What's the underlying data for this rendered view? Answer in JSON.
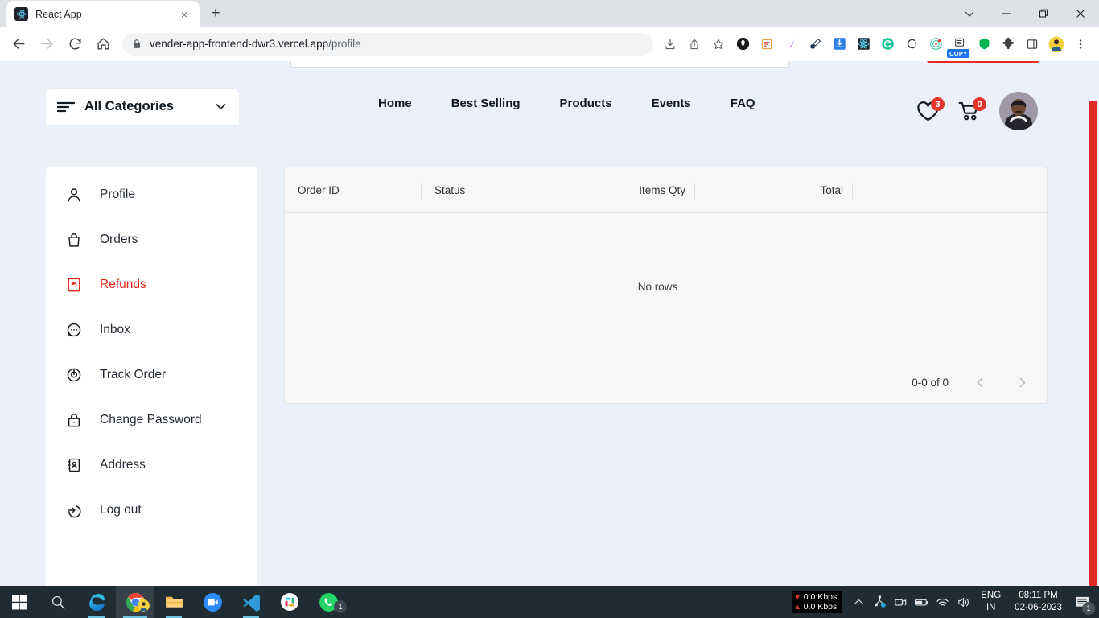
{
  "browser": {
    "tab": {
      "title": "React App",
      "favicon": "react-icon",
      "close": "×"
    },
    "new_tab": "+",
    "window_controls": {
      "minimize": "—",
      "maximize": "❐",
      "close": "✕",
      "tab_search": "⌄"
    },
    "nav": {
      "back": "←",
      "forward": "→",
      "reload": "↻",
      "home": "⌂"
    },
    "omnibox": {
      "lock": "lock-icon",
      "url_host": "vender-app-frontend-dwr3.vercel.app",
      "url_path": "/profile"
    },
    "toolbar_icons": [
      "install-icon",
      "share-icon",
      "bookmark-star-icon",
      "brave-icon",
      "notes-extension-icon",
      "gradient-extension-icon",
      "eyedropper-icon",
      "download-manager-icon",
      "react-devtools-icon",
      "grammarly-icon",
      "c-extension-icon",
      "target-extension-icon",
      "copy-extension-icon",
      "shield-extension-icon",
      "puzzle-extensions-icon",
      "sidepanel-icon",
      "profile-avatar-icon",
      "kebab-menu-icon"
    ],
    "copy_badge_label": "COPY"
  },
  "site": {
    "categories": {
      "label": "All Categories",
      "icon": "menu-lines-icon",
      "chevron": "chevron-down-icon"
    },
    "nav_links": [
      {
        "label": "Home"
      },
      {
        "label": "Best Selling"
      },
      {
        "label": "Products"
      },
      {
        "label": "Events"
      },
      {
        "label": "FAQ"
      }
    ],
    "wishlist": {
      "icon": "heart-icon",
      "count": "3"
    },
    "cart": {
      "icon": "cart-icon",
      "count": "0"
    },
    "avatar": {
      "icon": "user-avatar"
    }
  },
  "sidebar": {
    "items": [
      {
        "label": "Profile",
        "icon": "user-icon",
        "active": false
      },
      {
        "label": "Orders",
        "icon": "bag-icon",
        "active": false
      },
      {
        "label": "Refunds",
        "icon": "refund-icon",
        "active": true
      },
      {
        "label": "Inbox",
        "icon": "chat-bubble-icon",
        "active": false
      },
      {
        "label": "Track Order",
        "icon": "track-target-icon",
        "active": false
      },
      {
        "label": "Change Password",
        "icon": "lock-icon",
        "active": false
      },
      {
        "label": "Address",
        "icon": "address-book-icon",
        "active": false
      },
      {
        "label": "Log out",
        "icon": "logout-icon",
        "active": false
      }
    ],
    "active_color": "#e2231a"
  },
  "table": {
    "columns": [
      {
        "label": "Order ID"
      },
      {
        "label": "Status"
      },
      {
        "label": "Items Qty"
      },
      {
        "label": "Total"
      }
    ],
    "empty_message": "No rows",
    "pagination": {
      "range_label": "0-0 of 0",
      "prev_icon": "chevron-left-icon",
      "next_icon": "chevron-right-icon"
    }
  },
  "taskbar": {
    "apps": [
      {
        "name": "start-button",
        "icon": "windows-logo-icon"
      },
      {
        "name": "search-button",
        "icon": "search-icon"
      },
      {
        "name": "edge",
        "icon": "edge-icon"
      },
      {
        "name": "chrome",
        "icon": "chrome-icon"
      },
      {
        "name": "file-explorer",
        "icon": "folder-icon"
      },
      {
        "name": "zoom",
        "icon": "zoom-icon"
      },
      {
        "name": "vscode",
        "icon": "vscode-icon"
      },
      {
        "name": "slack",
        "icon": "slack-icon"
      },
      {
        "name": "whatsapp",
        "icon": "whatsapp-icon",
        "badge": "1"
      }
    ],
    "network_meter": {
      "down": "0.0 Kbps",
      "up": "0.0 Kbps"
    },
    "tray_icons": [
      "chevron-up-icon",
      "network-hub-icon",
      "camera-icon",
      "battery-icon",
      "wifi-icon",
      "volume-icon"
    ],
    "language": {
      "line1": "ENG",
      "line2": "IN"
    },
    "clock": {
      "time": "08:11 PM",
      "date": "02-06-2023"
    },
    "notifications": {
      "icon": "notification-icon",
      "count": "1"
    }
  }
}
